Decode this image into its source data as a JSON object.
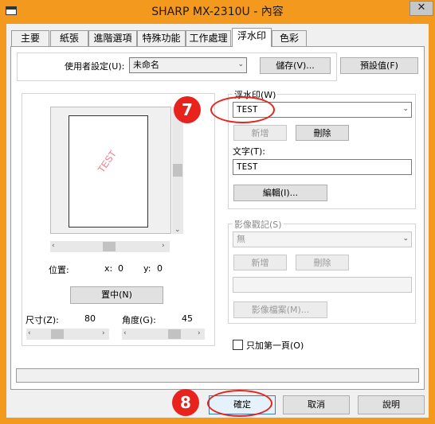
{
  "window": {
    "title": "SHARP MX-2310U - 內容",
    "close_glyph": "✕"
  },
  "tabs": [
    {
      "label": "主要"
    },
    {
      "label": "紙張"
    },
    {
      "label": "進階選項"
    },
    {
      "label": "特殊功能"
    },
    {
      "label": "工作處理"
    },
    {
      "label": "浮水印"
    },
    {
      "label": "色彩"
    }
  ],
  "user_settings": {
    "label": "使用者設定(U):",
    "value": "未命名",
    "save_button": "儲存(V)...",
    "default_button": "預設值(F)"
  },
  "preview": {
    "watermark_text": "TEST",
    "position_label": "位置:",
    "x_label": "x:",
    "x_value": "0",
    "y_label": "y:",
    "y_value": "0",
    "center_button": "置中(N)"
  },
  "size": {
    "label": "尺寸(Z):",
    "value": "80"
  },
  "angle": {
    "label": "角度(G):",
    "value": "45"
  },
  "watermark": {
    "label": "浮水印(W)",
    "selected": "TEST",
    "add_button": "新增",
    "delete_button": "刪除",
    "text_label": "文字(T):",
    "text_value": "TEST",
    "edit_button": "編輯(I)..."
  },
  "image_stamp": {
    "label": "影像戳記(S)",
    "selected": "無",
    "add_button": "新增",
    "delete_button": "刪除",
    "file_button": "影像檔案(M)..."
  },
  "first_page_only": {
    "label": "只加第一頁(O)",
    "checked": false
  },
  "footer": {
    "ok_button": "確定",
    "cancel_button": "取消",
    "help_button": "說明"
  },
  "markers": {
    "marker_7": "7",
    "marker_8": "8"
  },
  "colors": {
    "accent": "#f39a1e",
    "marker": "#e8231e"
  }
}
